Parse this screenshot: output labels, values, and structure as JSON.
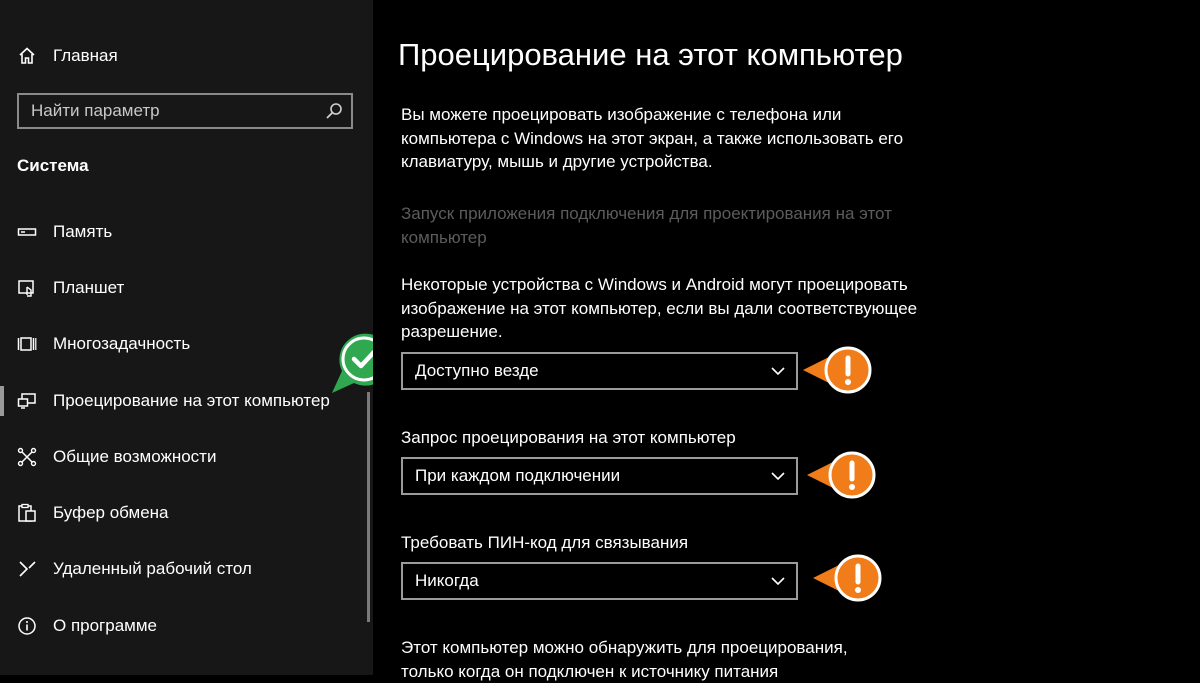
{
  "sidebar": {
    "home_label": "Главная",
    "search_placeholder": "Найти параметр",
    "section_title": "Система",
    "items": [
      {
        "label": "Память",
        "icon": "storage-icon"
      },
      {
        "label": "Планшет",
        "icon": "tablet-icon"
      },
      {
        "label": "Многозадачность",
        "icon": "multitasking-icon"
      },
      {
        "label": "Проецирование на этот компьютер",
        "icon": "projecting-icon",
        "active": true
      },
      {
        "label": "Общие возможности",
        "icon": "shared-experiences-icon"
      },
      {
        "label": "Буфер обмена",
        "icon": "clipboard-icon"
      },
      {
        "label": "Удаленный рабочий стол",
        "icon": "remote-desktop-icon"
      },
      {
        "label": "О программе",
        "icon": "info-icon"
      }
    ]
  },
  "main": {
    "title": "Проецирование на этот компьютер",
    "intro": "Вы можете проецировать изображение с телефона или компьютера с Windows на этот экран, а также использовать его клавиатуру, мышь и другие устройства.",
    "connect_app_link": "Запуск приложения подключения для проектирования на этот компьютер",
    "availability_desc": "Некоторые устройства с Windows и Android могут проецировать изображение на этот компьютер, если вы дали соответствующее разрешение.",
    "availability_value": "Доступно везде",
    "ask_label": "Запрос проецирования на этот компьютер",
    "ask_value": "При каждом подключении",
    "pin_label": "Требовать ПИН-код для связывания",
    "pin_value": "Никогда",
    "power_note": "Этот компьютер можно обнаружить для проецирования, только когда он подключен к источнику питания"
  },
  "colors": {
    "accent_green": "#2fa84f",
    "warning_orange": "#f07d1a",
    "sidebar_bg": "#171717"
  }
}
